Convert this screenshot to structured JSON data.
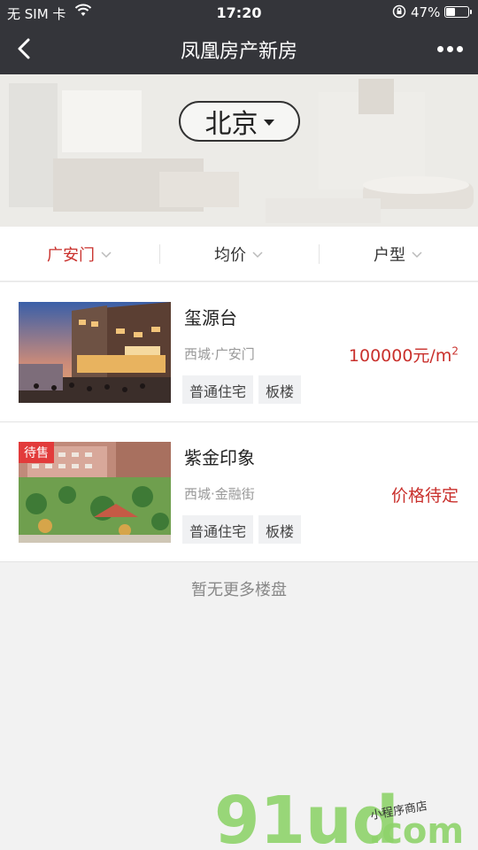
{
  "status_bar": {
    "carrier": "无 SIM 卡",
    "time": "17:20",
    "battery_percent": "47%",
    "battery_level": 0.47
  },
  "nav": {
    "title": "凤凰房产新房"
  },
  "banner": {
    "city": "北京"
  },
  "filters": [
    {
      "label": "广安门",
      "active": true
    },
    {
      "label": "均价",
      "active": false
    },
    {
      "label": "户型",
      "active": false
    }
  ],
  "listings": [
    {
      "name": "玺源台",
      "location": "西城·广安门",
      "price": "100000元/m",
      "price_sup": "2",
      "tags": [
        "普通住宅",
        "板楼"
      ],
      "badge": ""
    },
    {
      "name": "紫金印象",
      "location": "西城·金融街",
      "price": "价格待定",
      "price_sup": "",
      "tags": [
        "普通住宅",
        "板楼"
      ],
      "badge": "待售"
    }
  ],
  "footer": {
    "message": "暂无更多楼盘"
  },
  "watermark": {
    "logo": "91ud",
    "domain": ".com",
    "tagline": "小程序商店"
  },
  "colors": {
    "topbar": "#34353a",
    "accent": "#c9302c",
    "badge": "#e23b3b",
    "watermark_green": "#8fd36b"
  }
}
